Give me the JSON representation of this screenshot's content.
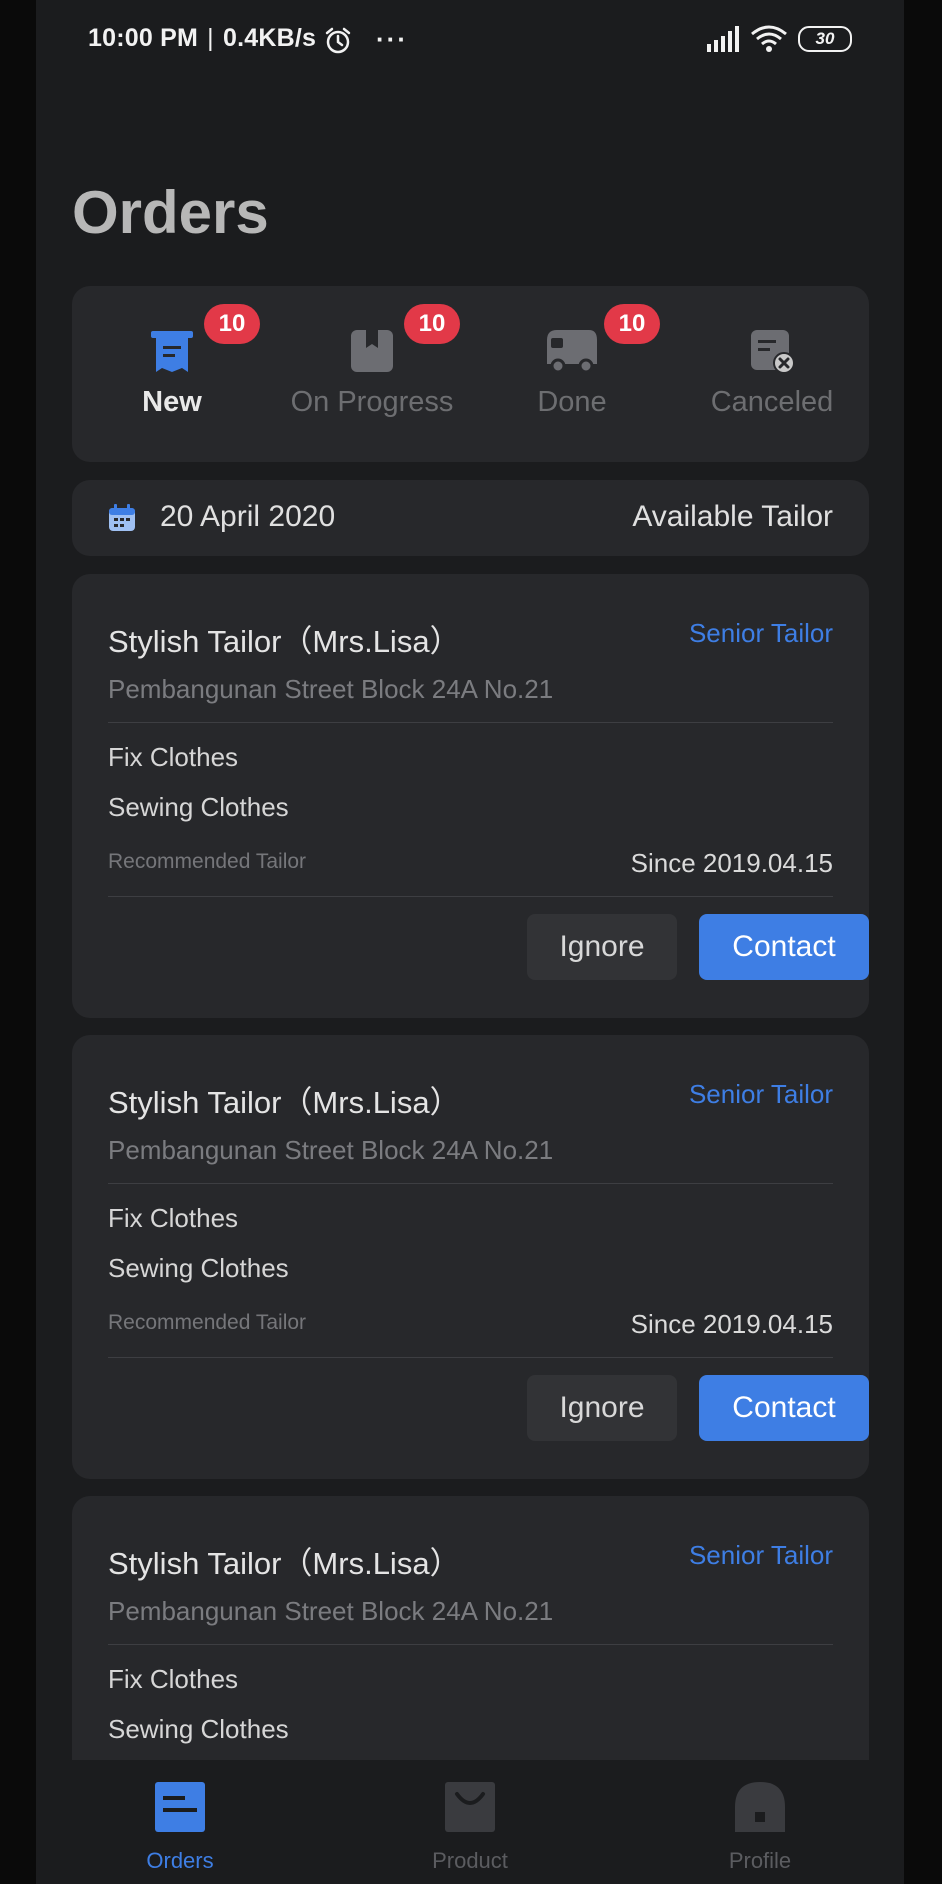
{
  "status_bar": {
    "time": "10:00 PM",
    "separator": "|",
    "net_speed": "0.4KB/s",
    "more": "···",
    "battery": "30"
  },
  "page": {
    "title": "Orders"
  },
  "tabs": [
    {
      "label": "New",
      "badge": "10",
      "icon": "receipt-icon",
      "active": true
    },
    {
      "label": "On Progress",
      "badge": "10",
      "icon": "package-icon",
      "active": false
    },
    {
      "label": "Done",
      "badge": "10",
      "icon": "truck-icon",
      "active": false
    },
    {
      "label": "Canceled",
      "badge": "",
      "icon": "canceled-doc-icon",
      "active": false
    }
  ],
  "date_bar": {
    "date": "20 April 2020",
    "available": "Available Tailor"
  },
  "tailors": [
    {
      "name": "Stylish Tailor（Mrs.Lisa）",
      "level": "Senior Tailor",
      "address": "Pembangunan Street Block 24A No.21",
      "services": [
        "Fix Clothes",
        "Sewing Clothes"
      ],
      "recommended": "Recommended Tailor",
      "since": "Since 2019.04.15",
      "ignore_label": "Ignore",
      "contact_label": "Contact"
    },
    {
      "name": "Stylish Tailor（Mrs.Lisa）",
      "level": "Senior Tailor",
      "address": "Pembangunan Street Block 24A No.21",
      "services": [
        "Fix Clothes",
        "Sewing Clothes"
      ],
      "recommended": "Recommended Tailor",
      "since": "Since 2019.04.15",
      "ignore_label": "Ignore",
      "contact_label": "Contact"
    },
    {
      "name": "Stylish Tailor（Mrs.Lisa）",
      "level": "Senior Tailor",
      "address": "Pembangunan Street Block 24A No.21",
      "services": [
        "Fix Clothes",
        "Sewing Clothes"
      ]
    }
  ],
  "bottom_nav": [
    {
      "label": "Orders",
      "icon": "orders-icon",
      "active": true
    },
    {
      "label": "Product",
      "icon": "shopping-bag-icon",
      "active": false
    },
    {
      "label": "Profile",
      "icon": "profile-icon",
      "active": false
    }
  ],
  "colors": {
    "accent": "#3e7ee4",
    "badge": "#e23948",
    "background": "#1b1c1e",
    "card": "#27282b"
  }
}
